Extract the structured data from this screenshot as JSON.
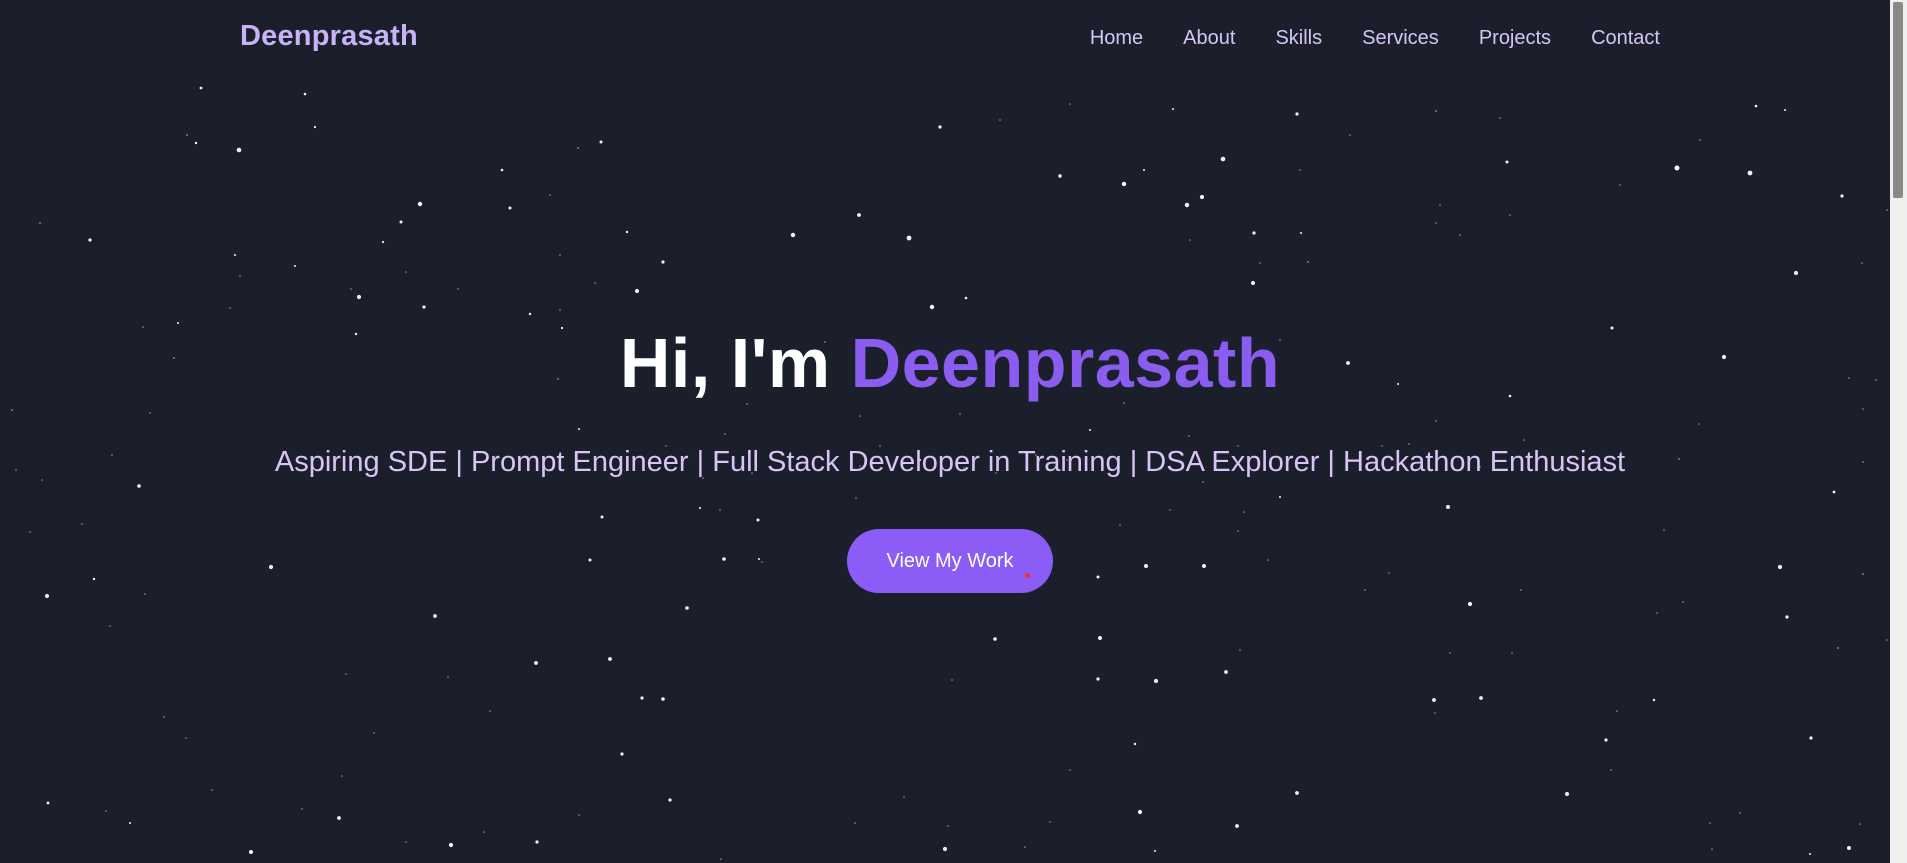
{
  "brand": {
    "name": "Deenprasath",
    "color": "#c9b2f5"
  },
  "nav": {
    "items": [
      {
        "label": "Home"
      },
      {
        "label": "About"
      },
      {
        "label": "Skills"
      },
      {
        "label": "Services"
      },
      {
        "label": "Projects"
      },
      {
        "label": "Contact"
      }
    ]
  },
  "hero": {
    "greeting": "Hi, I'm",
    "name": "Deenprasath",
    "subtitle": "Aspiring SDE | Prompt Engineer | Full Stack Developer in Training | DSA Explorer | Hackathon Enthusiast",
    "cta_label": "View My Work"
  },
  "colors": {
    "background": "#1b1f2c",
    "accent": "#8b5cf6",
    "text_light": "#d8c4f6",
    "star": "#ffffff"
  }
}
